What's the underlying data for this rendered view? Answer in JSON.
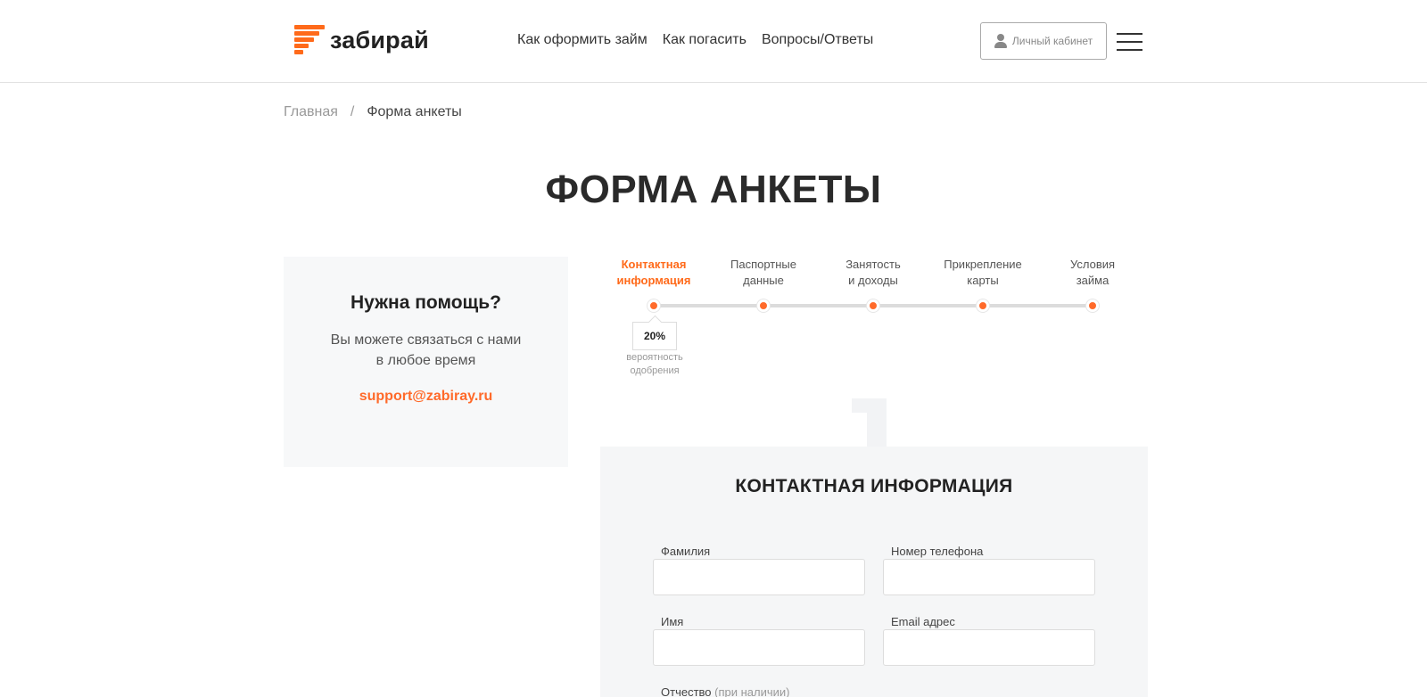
{
  "brand": {
    "name": "забирай",
    "accent": "#ff6a1a"
  },
  "nav": {
    "items": [
      {
        "label": "Как оформить займ"
      },
      {
        "label": "Как погасить"
      },
      {
        "label": "Вопросы/Ответы"
      }
    ],
    "cabinet_label": "Личный кабинет"
  },
  "breadcrumb": {
    "home": "Главная",
    "separator": "/",
    "current": "Форма анкеты"
  },
  "page_title": "ФОРМА АНКЕТЫ",
  "help": {
    "title": "Нужна помощь?",
    "text_line1": "Вы можете связаться с нами",
    "text_line2": "в любое время",
    "email": "support@zabiray.ru"
  },
  "steps": [
    {
      "line1": "Контактная",
      "line2": "информация",
      "active": true
    },
    {
      "line1": "Паспортные",
      "line2": "данные",
      "active": false
    },
    {
      "line1": "Занятость",
      "line2": "и доходы",
      "active": false
    },
    {
      "line1": "Прикрепление",
      "line2": "карты",
      "active": false
    },
    {
      "line1": "Условия",
      "line2": "займа",
      "active": false
    }
  ],
  "approval": {
    "value": "20%",
    "caption_line1": "вероятность",
    "caption_line2": "одобрения"
  },
  "form": {
    "title": "КОНТАКТНАЯ ИНФОРМАЦИЯ",
    "fields": {
      "last_name": {
        "label": "Фамилия",
        "value": ""
      },
      "phone": {
        "label": "Номер телефона",
        "value": ""
      },
      "first_name": {
        "label": "Имя",
        "value": ""
      },
      "email": {
        "label": "Email адрес",
        "value": ""
      },
      "middle_name": {
        "label": "Отчество",
        "hint": "(при наличии)"
      }
    }
  }
}
